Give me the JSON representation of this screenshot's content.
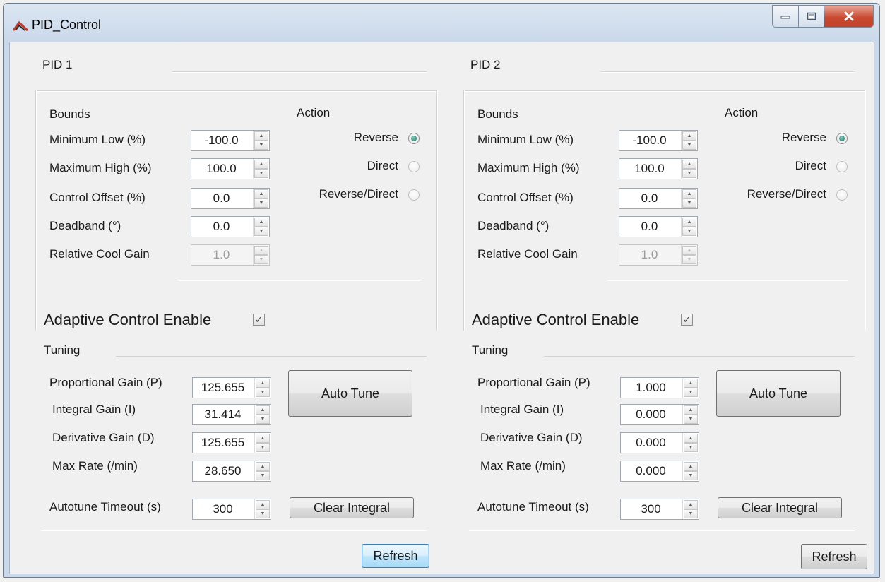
{
  "window": {
    "title": "PID_Control"
  },
  "icons": {
    "app": "pid-app-icon",
    "minimize": "minimize-icon",
    "maximize": "maximize-icon",
    "close": "close-icon"
  },
  "panels": [
    {
      "title": "PID 1",
      "bounds_title": "Bounds",
      "bounds": [
        {
          "label": "Minimum Low (%)",
          "value": "-100.0",
          "enabled": true
        },
        {
          "label": "Maximum High (%)",
          "value": "100.0",
          "enabled": true
        },
        {
          "label": "Control Offset (%)",
          "value": "0.0",
          "enabled": true
        },
        {
          "label": "Deadband (°)",
          "value": "0.0",
          "enabled": true
        },
        {
          "label": "Relative Cool Gain",
          "value": "1.0",
          "enabled": false
        }
      ],
      "action_title": "Action",
      "actions": [
        {
          "label": "Reverse",
          "checked": true
        },
        {
          "label": "Direct",
          "checked": false
        },
        {
          "label": "Reverse/Direct",
          "checked": false
        }
      ],
      "adaptive_label": "Adaptive Control Enable",
      "adaptive_checked": true,
      "tuning_title": "Tuning",
      "tuning": [
        {
          "label": "Proportional Gain (P)",
          "value": "125.655"
        },
        {
          "label": "Integral Gain (I)",
          "value": "31.414"
        },
        {
          "label": "Derivative Gain (D)",
          "value": "125.655"
        },
        {
          "label": "Max Rate (/min)",
          "value": "28.650"
        }
      ],
      "autotune_timeout_label": "Autotune Timeout (s)",
      "autotune_timeout_value": "300",
      "auto_tune_button": "Auto Tune",
      "clear_integral_button": "Clear Integral",
      "refresh_button": "Refresh"
    },
    {
      "title": "PID 2",
      "bounds_title": "Bounds",
      "bounds": [
        {
          "label": "Minimum Low (%)",
          "value": "-100.0",
          "enabled": true
        },
        {
          "label": "Maximum High (%)",
          "value": "100.0",
          "enabled": true
        },
        {
          "label": "Control Offset (%)",
          "value": "0.0",
          "enabled": true
        },
        {
          "label": "Deadband (°)",
          "value": "0.0",
          "enabled": true
        },
        {
          "label": "Relative Cool Gain",
          "value": "1.0",
          "enabled": false
        }
      ],
      "action_title": "Action",
      "actions": [
        {
          "label": "Reverse",
          "checked": true
        },
        {
          "label": "Direct",
          "checked": false
        },
        {
          "label": "Reverse/Direct",
          "checked": false
        }
      ],
      "adaptive_label": "Adaptive Control Enable",
      "adaptive_checked": true,
      "tuning_title": "Tuning",
      "tuning": [
        {
          "label": "Proportional Gain (P)",
          "value": "1.000"
        },
        {
          "label": "Integral Gain (I)",
          "value": "0.000"
        },
        {
          "label": "Derivative Gain (D)",
          "value": "0.000"
        },
        {
          "label": "Max Rate (/min)",
          "value": "0.000"
        }
      ],
      "autotune_timeout_label": "Autotune Timeout (s)",
      "autotune_timeout_value": "300",
      "auto_tune_button": "Auto Tune",
      "clear_integral_button": "Clear Integral",
      "refresh_button": "Refresh"
    }
  ]
}
